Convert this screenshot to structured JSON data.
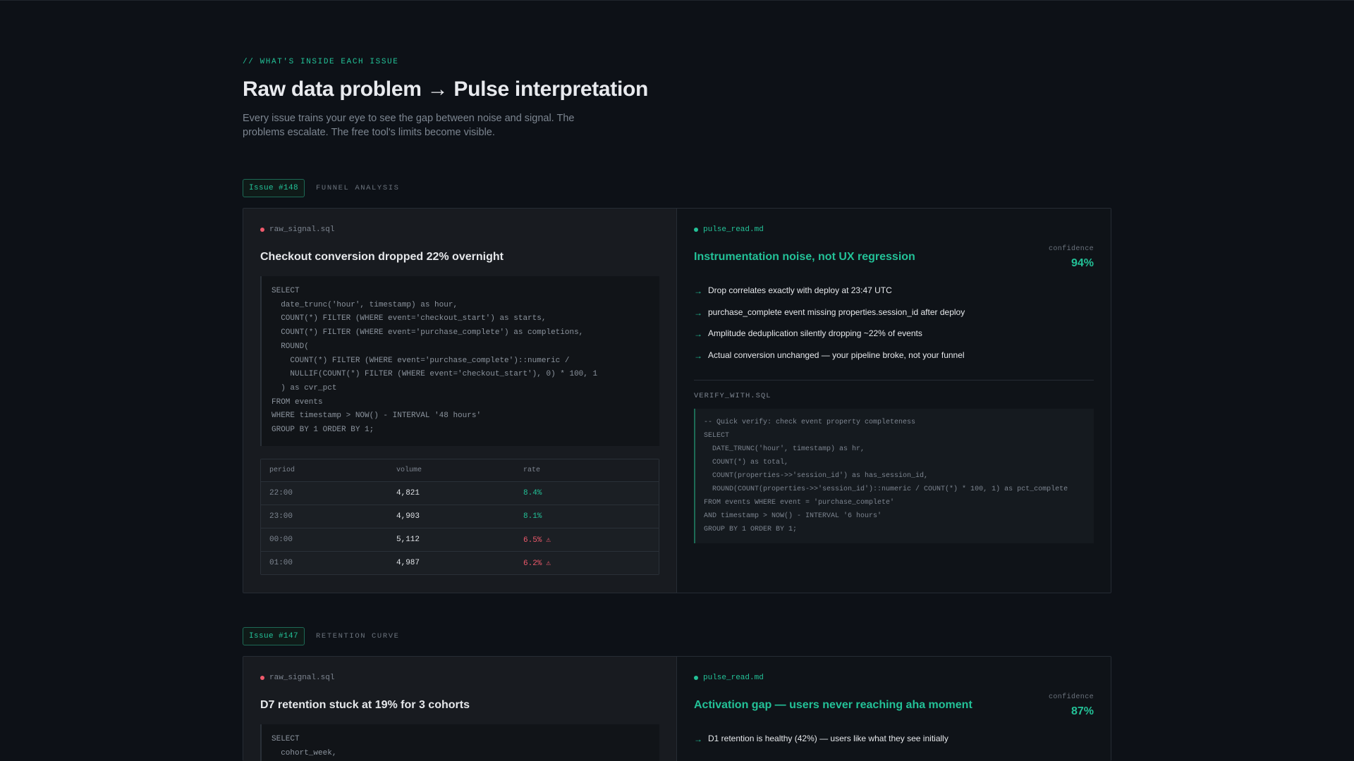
{
  "header": {
    "eyebrow": "// WHAT'S INSIDE EACH ISSUE",
    "headline": "Raw data problem → Pulse interpretation",
    "lede": "Every issue trains your eye to see the gap between noise and signal. The problems escalate. The free tool's limits become visible."
  },
  "colors": {
    "accent": "#23c197",
    "alert": "#f05a6c",
    "background": "#0d1117"
  },
  "issues": [
    {
      "badge": "Issue #148",
      "kind": "FUNNEL ANALYSIS",
      "raw": {
        "file": "raw_signal.sql",
        "title": "Checkout conversion dropped 22% overnight",
        "code": "SELECT\n  date_trunc('hour', timestamp) as hour,\n  COUNT(*) FILTER (WHERE event='checkout_start') as starts,\n  COUNT(*) FILTER (WHERE event='purchase_complete') as completions,\n  ROUND(\n    COUNT(*) FILTER (WHERE event='purchase_complete')::numeric /\n    NULLIF(COUNT(*) FILTER (WHERE event='checkout_start'), 0) * 100, 1\n  ) as cvr_pct\nFROM events\nWHERE timestamp > NOW() - INTERVAL '48 hours'\nGROUP BY 1 ORDER BY 1;",
        "table": {
          "headers": [
            "period",
            "volume",
            "rate"
          ],
          "rows": [
            {
              "period": "22:00",
              "volume": "4,821",
              "rate": "8.4%",
              "alert": false
            },
            {
              "period": "23:00",
              "volume": "4,903",
              "rate": "8.1%",
              "alert": false
            },
            {
              "period": "00:00",
              "volume": "5,112",
              "rate": "6.5%",
              "alert": true
            },
            {
              "period": "01:00",
              "volume": "4,987",
              "rate": "6.2%",
              "alert": true
            }
          ]
        }
      },
      "pulse": {
        "file": "pulse_read.md",
        "title": "Instrumentation noise, not UX regression",
        "confidence_label": "confidence",
        "confidence": "94%",
        "bullets": [
          "Drop correlates exactly with deploy at 23:47 UTC",
          "purchase_complete event missing properties.session_id after deploy",
          "Amplitude deduplication silently dropping ~22% of events",
          "Actual conversion unchanged — your pipeline broke, not your funnel"
        ],
        "verify_label": "VERIFY_WITH.SQL",
        "verify_code": "-- Quick verify: check event property completeness\nSELECT\n  DATE_TRUNC('hour', timestamp) as hr,\n  COUNT(*) as total,\n  COUNT(properties->>'session_id') as has_session_id,\n  ROUND(COUNT(properties->>'session_id')::numeric / COUNT(*) * 100, 1) as pct_complete\nFROM events WHERE event = 'purchase_complete'\nAND timestamp > NOW() - INTERVAL '6 hours'\nGROUP BY 1 ORDER BY 1;"
      }
    },
    {
      "badge": "Issue #147",
      "kind": "RETENTION CURVE",
      "raw": {
        "file": "raw_signal.sql",
        "title": "D7 retention stuck at 19% for 3 cohorts",
        "code": "SELECT\n  cohort_week,"
      },
      "pulse": {
        "file": "pulse_read.md",
        "title": "Activation gap — users never reaching aha moment",
        "confidence_label": "confidence",
        "confidence": "87%",
        "bullets": [
          "D1 retention is healthy (42%) — users like what they see initially"
        ]
      }
    }
  ]
}
